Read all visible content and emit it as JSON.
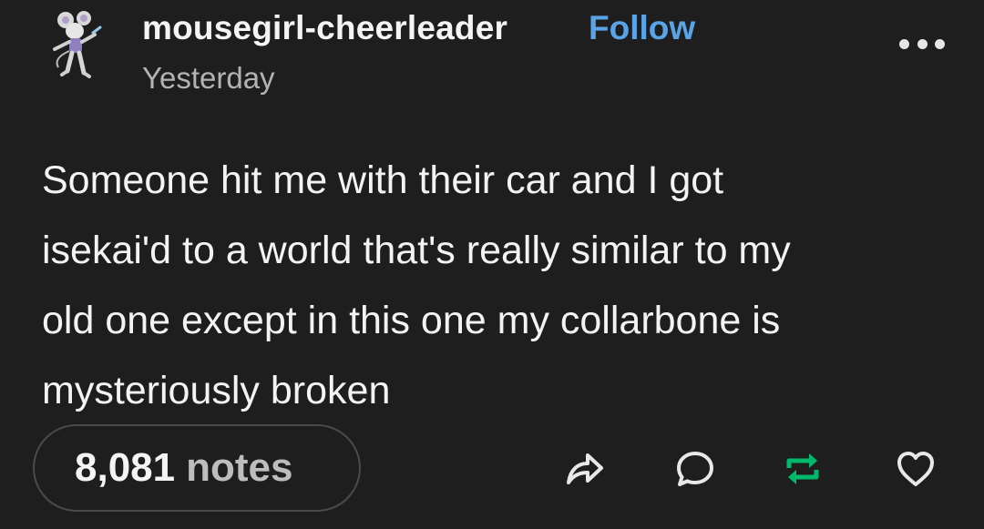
{
  "post": {
    "username": "mousegirl-cheerleader",
    "follow_label": "Follow",
    "timestamp": "Yesterday",
    "body_lines": [
      "Someone hit me with their car and I got",
      "isekai'd to a world that's really similar to my",
      "old one except in this one my collarbone is",
      "mysteriously broken"
    ],
    "notes_count": "8,081",
    "notes_label": "notes"
  },
  "icons": {
    "more": "more-options-icon",
    "share": "share-icon",
    "reply": "reply-icon",
    "reblog": "reblog-icon",
    "like": "heart-icon"
  },
  "colors": {
    "background": "#1e1e1e",
    "follow": "#5aa3e6",
    "reblog": "#00b86b",
    "text": "#f3f3f3",
    "muted": "#b3b3b3"
  }
}
